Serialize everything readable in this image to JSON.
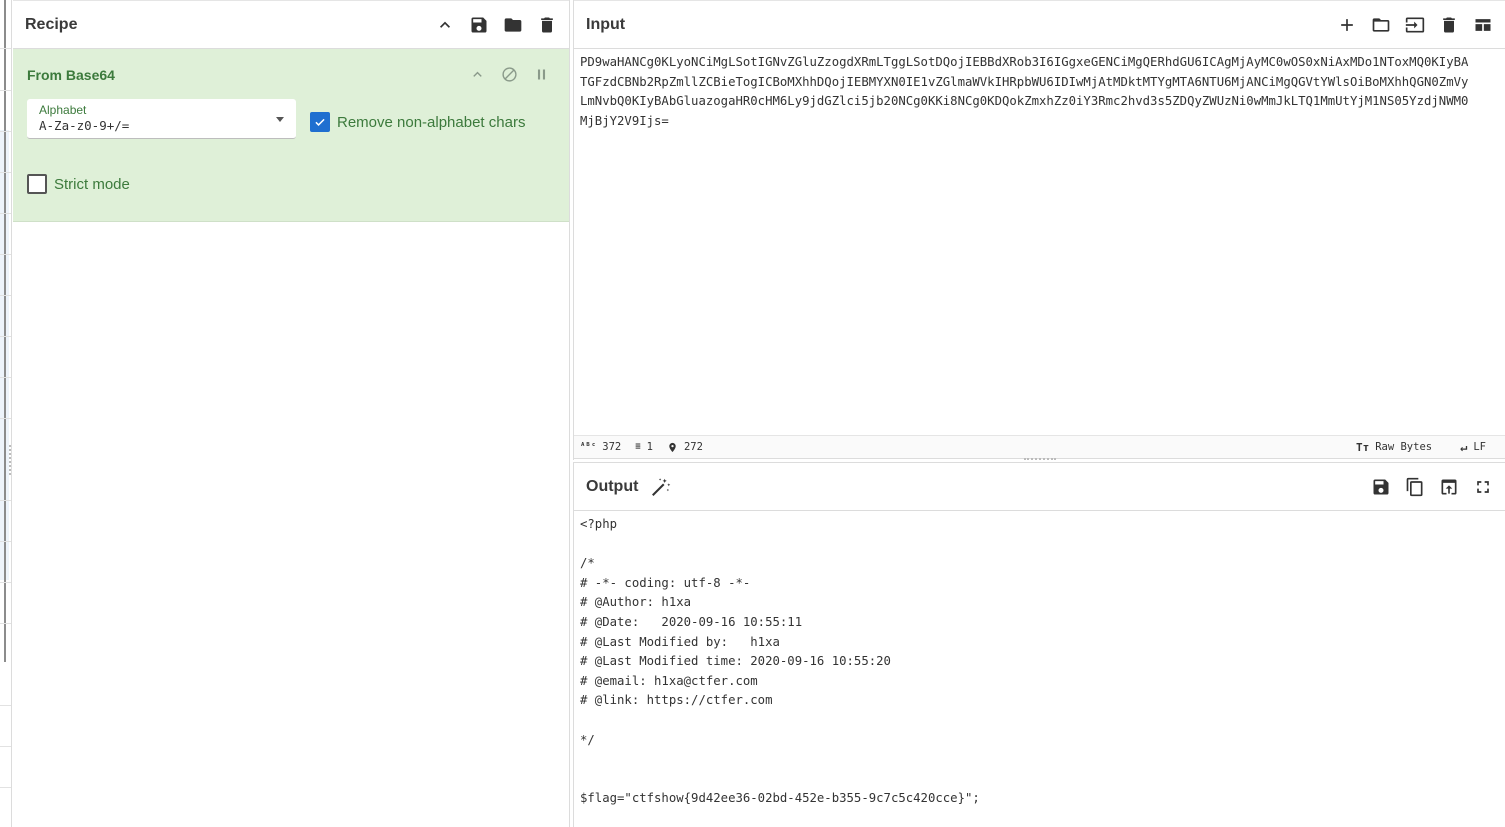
{
  "recipe": {
    "title": "Recipe",
    "icons": [
      "chevron-up-icon",
      "save-icon",
      "folder-icon",
      "trash-icon"
    ],
    "operation": {
      "title": "From Base64",
      "alphabet_label": "Alphabet",
      "alphabet_value": "A-Za-z0-9+/=",
      "remove_non_alpha_label": "Remove non-alphabet chars",
      "remove_non_alpha_checked": true,
      "strict_mode_label": "Strict mode",
      "strict_mode_checked": false
    }
  },
  "input": {
    "title": "Input",
    "lines": [
      "PD9waHANCg0KLyoNCiMgLSotIGNvZGluZzogdXRmLTggLSotDQojIEBBdXRob3I6IGgxeGENCiMgQERhdGU6ICAgMjAyMC0wOS0xNiAxMDo1NToxMQ0KIyBA",
      "TGFzdCBNb2RpZmllZCBieTogICBoMXhhDQojIEBMYXN0IE1vZGlmaWVkIHRpbWU6IDIwMjAtMDktMTYgMTA6NTU6MjANCiMgQGVtYWlsOiBoMXhhQGN0ZmVy",
      "LmNvbQ0KIyBAbGluazogaHR0cHM6Ly9jdGZlci5jb20NCg0KKi8NCg0KDQokZmxhZz0iY3Rmc2hvd3s5ZDQyZWUzNi0wMmJkLTQ1MmUtYjM1NS05YzdjNWM0",
      "MjBjY2V9Ijs="
    ],
    "status": {
      "length": "372",
      "lines": "1",
      "position": "272",
      "encoding": "Raw Bytes",
      "eol": "LF"
    }
  },
  "output": {
    "title": "Output",
    "lines": [
      "<?php",
      "",
      "/*",
      "# -*- coding: utf-8 -*-",
      "# @Author: h1xa",
      "# @Date:   2020-09-16 10:55:11",
      "# @Last Modified by:   h1xa",
      "# @Last Modified time: 2020-09-16 10:55:20",
      "# @email: h1xa@ctfer.com",
      "# @link: https://ctfer.com",
      "",
      "*/",
      "",
      "",
      "$flag=\"ctfshow{9d42ee36-02bd-452e-b355-9c7c5c420cce}\";"
    ]
  },
  "colors": {
    "operation_bg": "#dff0d8",
    "operation_text": "#3c7a3c",
    "checkbox_checked": "#1f6fd0"
  }
}
